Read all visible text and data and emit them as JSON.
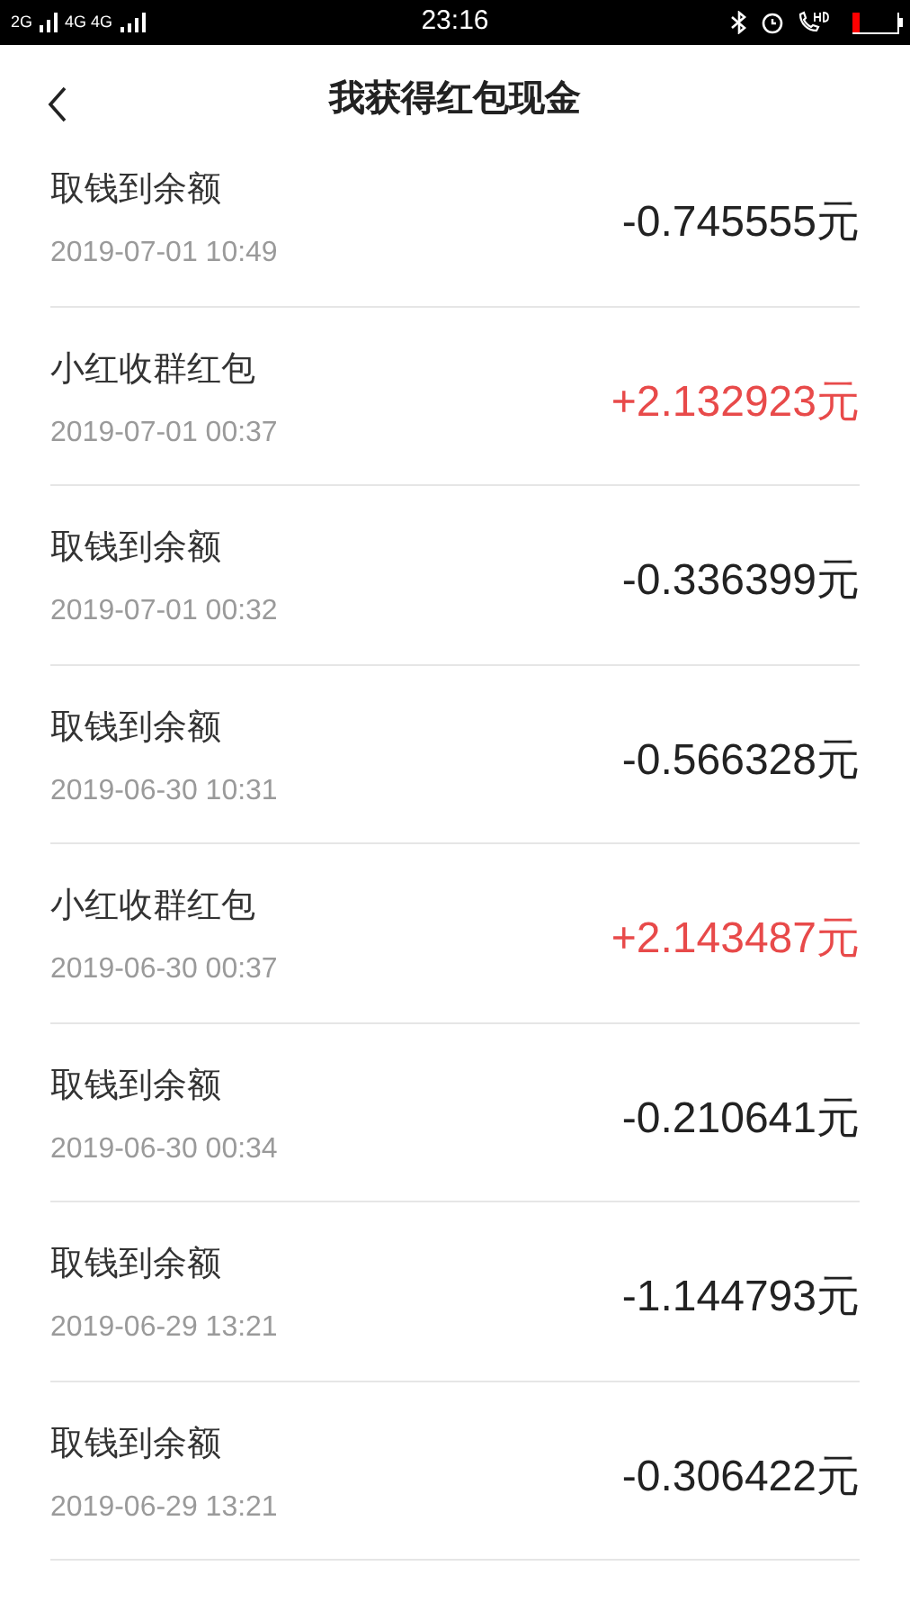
{
  "status_bar": {
    "network_left": "2G",
    "network_right": "4G 4G",
    "time": "23:16"
  },
  "header": {
    "title": "我获得红包现金"
  },
  "records": [
    {
      "title": "取钱到余额",
      "time": "2019-07-01 10:49",
      "amount": "-0.745555元",
      "kind": "expense"
    },
    {
      "title": "小红收群红包",
      "time": "2019-07-01 00:37",
      "amount": "+2.132923元",
      "kind": "income"
    },
    {
      "title": "取钱到余额",
      "time": "2019-07-01 00:32",
      "amount": "-0.336399元",
      "kind": "expense"
    },
    {
      "title": "取钱到余额",
      "time": "2019-06-30 10:31",
      "amount": "-0.566328元",
      "kind": "expense"
    },
    {
      "title": "小红收群红包",
      "time": "2019-06-30 00:37",
      "amount": "+2.143487元",
      "kind": "income"
    },
    {
      "title": "取钱到余额",
      "time": "2019-06-30 00:34",
      "amount": "-0.210641元",
      "kind": "expense"
    },
    {
      "title": "取钱到余额",
      "time": "2019-06-29 13:21",
      "amount": "-1.144793元",
      "kind": "expense"
    },
    {
      "title": "取钱到余额",
      "time": "2019-06-29 13:21",
      "amount": "-0.306422元",
      "kind": "expense"
    }
  ]
}
